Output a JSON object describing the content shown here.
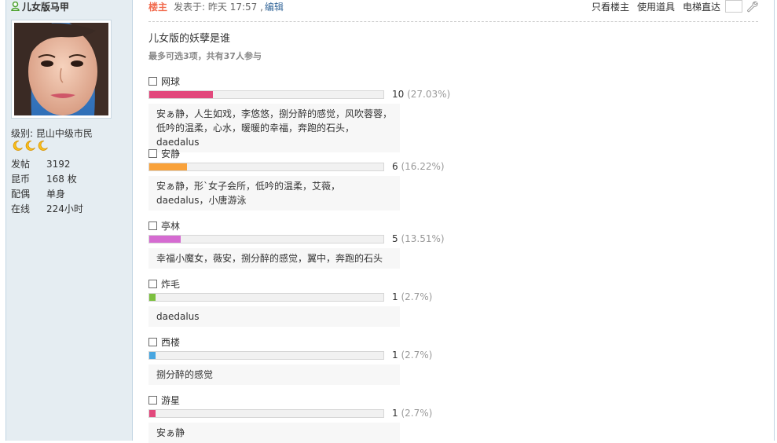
{
  "author": {
    "name": "儿女版马甲",
    "level": "级别: 昆山中级市民",
    "stats": [
      {
        "label": "发帖",
        "value": "3192"
      },
      {
        "label": "昆币",
        "value": "168 枚"
      },
      {
        "label": "配偶",
        "value": "单身"
      },
      {
        "label": "在线",
        "value": "224小时"
      }
    ]
  },
  "post_header": {
    "owner_tag": "楼主",
    "time": "发表于: 昨天 17:57 ,",
    "edit": "编辑",
    "only_owner": "只看楼主",
    "use_tool": "使用道具",
    "elevator": "电梯直达"
  },
  "poll": {
    "title": "儿女版的妖孽是谁",
    "note": "最多可选3项，共有37人参与",
    "options": [
      {
        "name": "网球",
        "count": "10",
        "percent": "(27.03%)",
        "fraction": 0.2703,
        "color": "#e2487c",
        "voters": "安ぁ静，人生如戏，李悠悠，捌分醉的感觉，风吹蓉蓉，低吟的温柔，心水，暖暖的幸福，奔跑的石头，daedalus"
      },
      {
        "name": "安静",
        "count": "6",
        "percent": "(16.22%)",
        "fraction": 0.1622,
        "color": "#f9a23b",
        "voters": "安ぁ静，形`女子会所，低吟的温柔，艾薇，daedalus，小唐游泳"
      },
      {
        "name": "亭林",
        "count": "5",
        "percent": "(13.51%)",
        "fraction": 0.1351,
        "color": "#d56bd1",
        "voters": "幸福小魔女，薇安，捌分醉的感觉，翼中，奔跑的石头"
      },
      {
        "name": "炸毛",
        "count": "1",
        "percent": "(2.7%)",
        "fraction": 0.027,
        "color": "#7cc03f",
        "voters": "daedalus"
      },
      {
        "name": "西楼",
        "count": "1",
        "percent": "(2.7%)",
        "fraction": 0.027,
        "color": "#48a6e0",
        "voters": "捌分醉的感觉"
      },
      {
        "name": "游星",
        "count": "1",
        "percent": "(2.7%)",
        "fraction": 0.027,
        "color": "#e2487c",
        "voters": "安ぁ静"
      }
    ]
  }
}
